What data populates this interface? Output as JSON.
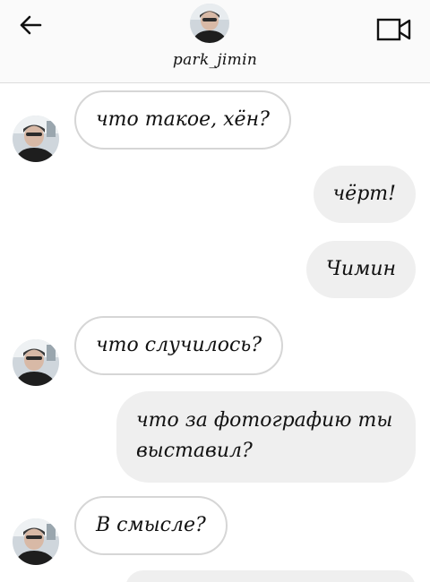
{
  "header": {
    "username": "park_jimin",
    "back_icon": "arrow-left-icon",
    "video_icon": "video-camera-icon"
  },
  "messages": [
    {
      "side": "in",
      "text": "что такое, хён?"
    },
    {
      "side": "out",
      "text": "чёрт!"
    },
    {
      "side": "out",
      "text": "Чимин"
    },
    {
      "side": "in",
      "text": "что случилось?"
    },
    {
      "side": "out",
      "text": "что за фотографию ты выставил?"
    },
    {
      "side": "in",
      "text": "В смысле?"
    }
  ],
  "colors": {
    "header_bg": "#fafafa",
    "outgoing_bubble": "#efefef",
    "incoming_border": "#d6d6d6",
    "text": "#111111"
  }
}
